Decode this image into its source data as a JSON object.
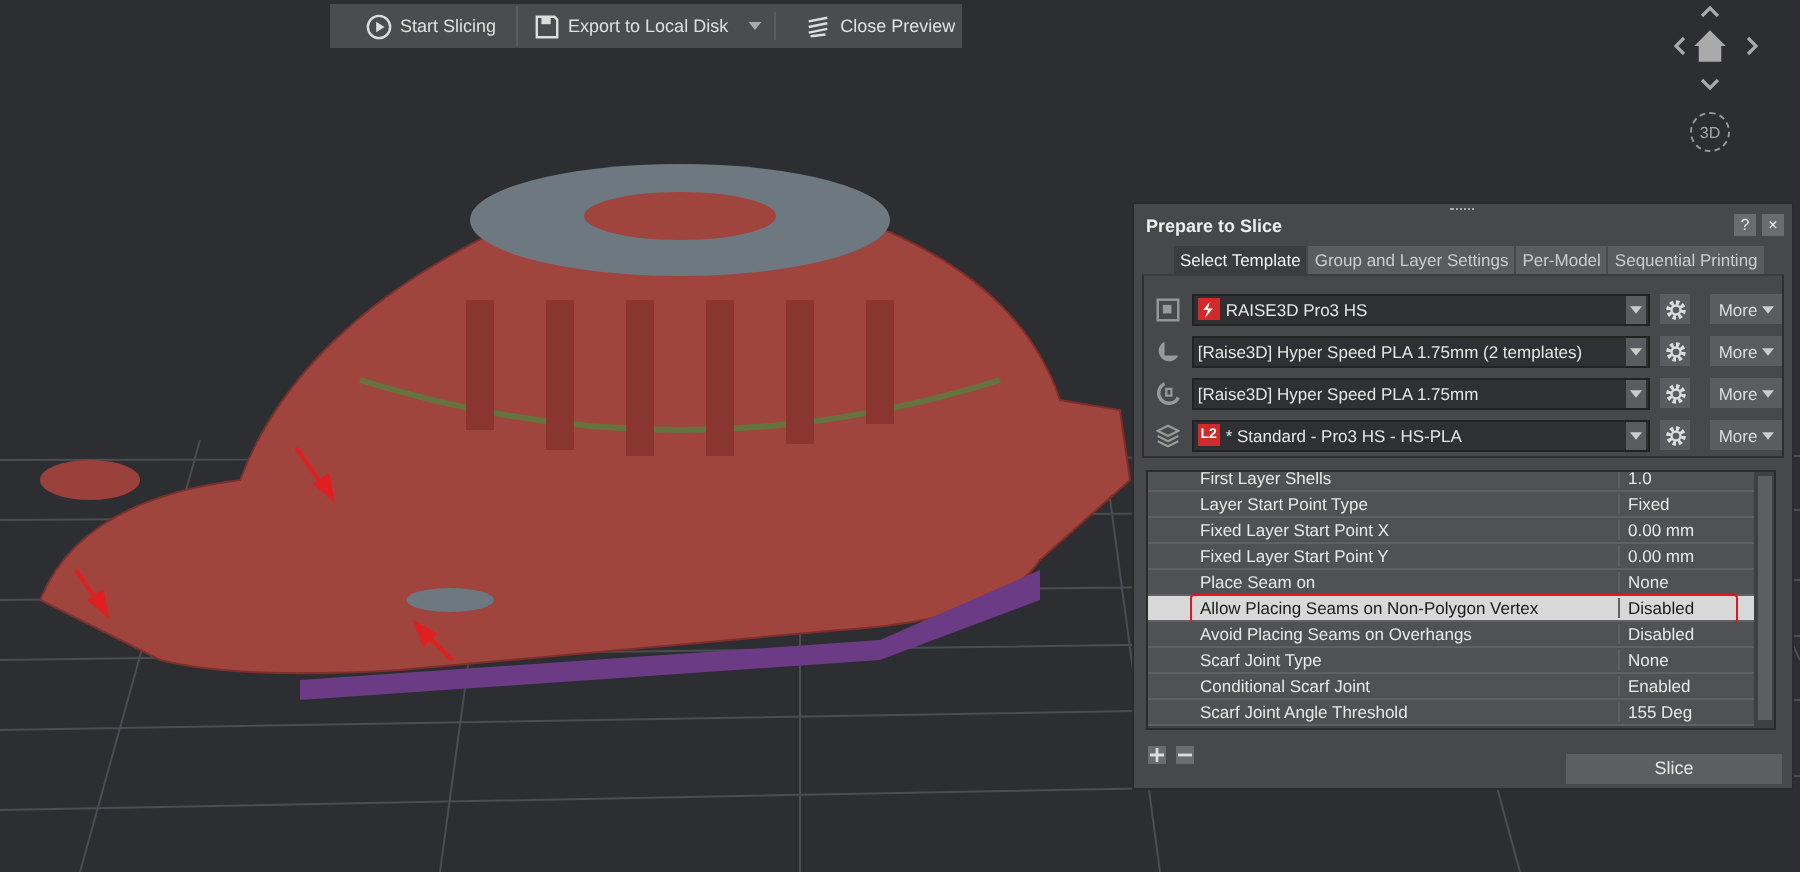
{
  "toolbar": {
    "buttons": [
      {
        "kind": "play",
        "label": "Start Slicing"
      },
      {
        "kind": "disk",
        "label": "Export to Local Disk",
        "dropdown": true
      },
      {
        "kind": "layers",
        "label": "Close Preview"
      }
    ]
  },
  "view_nav": {
    "label": "3D"
  },
  "panel": {
    "title": "Prepare to Slice",
    "help": "?",
    "close": "×",
    "tabs": [
      {
        "label": "Select Template",
        "selected": true
      },
      {
        "label": "Group and Layer Settings",
        "selected": false
      },
      {
        "label": "Per-Model",
        "selected": false
      },
      {
        "label": "Sequential Printing",
        "selected": false
      }
    ],
    "templates": [
      {
        "kind": "printer",
        "logo": true,
        "value": "RAISE3D Pro3 HS",
        "more": "More"
      },
      {
        "kind": "filament",
        "value": "[Raise3D] Hyper Speed PLA 1.75mm (2 templates)",
        "more": "More"
      },
      {
        "kind": "filament-alt",
        "value": "[Raise3D] Hyper Speed PLA 1.75mm",
        "more": "More"
      },
      {
        "kind": "layers",
        "badge": "L2",
        "value": "* Standard - Pro3 HS - HS-PLA",
        "more": "More"
      }
    ],
    "settings": [
      {
        "name": "First Layer Shells",
        "value": "1.0",
        "selected": false,
        "outlined": false
      },
      {
        "name": "Layer Start Point Type",
        "value": "Fixed",
        "selected": false,
        "outlined": false
      },
      {
        "name": "Fixed Layer Start Point X",
        "value": "0.00 mm",
        "selected": false,
        "outlined": false
      },
      {
        "name": "Fixed Layer Start Point Y",
        "value": "0.00 mm",
        "selected": false,
        "outlined": false
      },
      {
        "name": "Place Seam on",
        "value": "None",
        "selected": false,
        "outlined": false
      },
      {
        "name": "Allow Placing Seams on Non-Polygon Vertex",
        "value": "Disabled",
        "selected": true,
        "outlined": true
      },
      {
        "name": "Avoid Placing Seams on Overhangs",
        "value": "Disabled",
        "selected": false,
        "outlined": false
      },
      {
        "name": "Scarf Joint Type",
        "value": "None",
        "selected": false,
        "outlined": false
      },
      {
        "name": "Conditional Scarf Joint",
        "value": "Enabled",
        "selected": false,
        "outlined": false
      },
      {
        "name": "Scarf Joint Angle Threshold",
        "value": "155 Deg",
        "selected": false,
        "outlined": false
      }
    ],
    "slice_button": "Slice"
  }
}
